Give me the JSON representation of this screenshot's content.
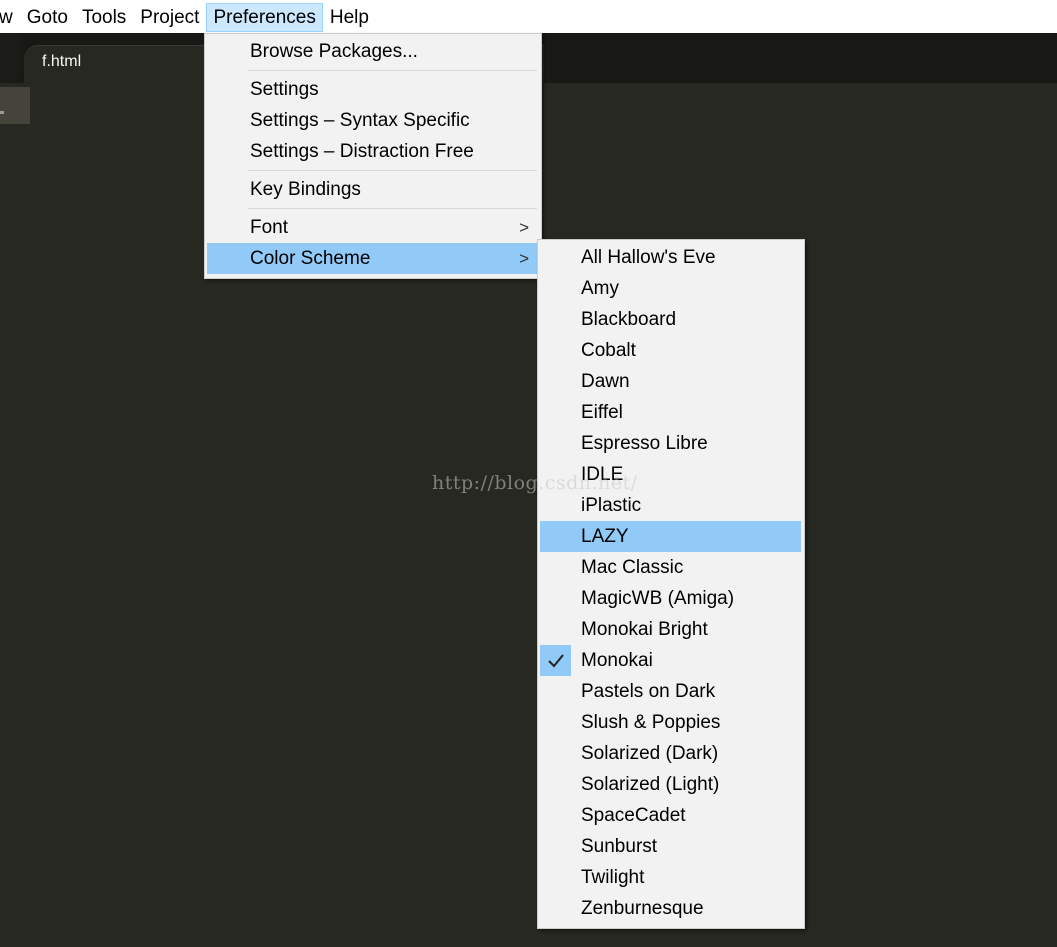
{
  "menubar": {
    "items": [
      "w",
      "Goto",
      "Tools",
      "Project",
      "Preferences",
      "Help"
    ],
    "open_item": "Preferences"
  },
  "tabs": [
    {
      "label": "f.html",
      "active": true
    }
  ],
  "preferences_menu": {
    "groups": [
      [
        {
          "label": "Browse Packages..."
        }
      ],
      [
        {
          "label": "Settings"
        },
        {
          "label": "Settings – Syntax Specific"
        },
        {
          "label": "Settings – Distraction Free"
        }
      ],
      [
        {
          "label": "Key Bindings"
        }
      ],
      [
        {
          "label": "Font",
          "submenu": true
        },
        {
          "label": "Color Scheme",
          "submenu": true,
          "highlighted": true
        }
      ]
    ],
    "submenu_arrow": ">"
  },
  "color_scheme_menu": {
    "items": [
      "All Hallow's Eve",
      "Amy",
      "Blackboard",
      "Cobalt",
      "Dawn",
      "Eiffel",
      "Espresso Libre",
      "IDLE",
      "iPlastic",
      "LAZY",
      "Mac Classic",
      "MagicWB (Amiga)",
      "Monokai Bright",
      "Monokai",
      "Pastels on Dark",
      "Slush & Poppies",
      "Solarized (Dark)",
      "Solarized (Light)",
      "SpaceCadet",
      "Sunburst",
      "Twilight",
      "Zenburnesque"
    ],
    "highlighted": "LAZY",
    "checked": "Monokai"
  },
  "watermark": "http://blog.csdn.net/",
  "colors": {
    "editor_bg": "#272822",
    "tabbar_bg": "#181914",
    "menu_bg": "#f2f2f2",
    "highlight": "#91c9f7",
    "menubar_open_bg": "#cce8ff"
  }
}
